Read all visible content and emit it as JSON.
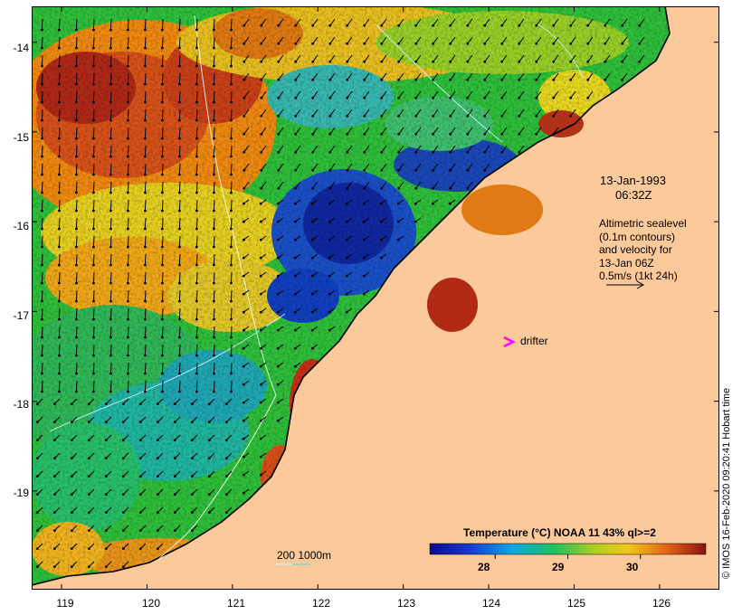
{
  "map": {
    "date_line": "13-Jan-1993",
    "time_line": "06:32Z",
    "legend_lines": [
      "Altimetric sealevel",
      "(0.1m contours)",
      "and velocity for",
      "13-Jan 06Z",
      "0.5m/s (1kt 24h)"
    ],
    "drifter_label": "drifter",
    "depth_label": "200  1000m",
    "colorbar_title": "Temperature (°C) NOAA 11 43% ql>=2",
    "colorbar_ticks": [
      "28",
      "29",
      "30"
    ],
    "colorbar_tick_values": [
      28,
      29,
      30
    ],
    "colorbar_range": [
      27.1,
      30.9
    ],
    "credit": "© IMOS 16-Feb-2020 09:20:41 Hobart time",
    "lon_ticks": [
      "119",
      "120",
      "121",
      "122",
      "123",
      "124",
      "125",
      "126"
    ],
    "lat_ticks": [
      "-14",
      "-15",
      "-16",
      "-17",
      "-18",
      "-19"
    ],
    "lon_values": [
      119,
      120,
      121,
      122,
      123,
      124,
      125,
      126
    ],
    "lat_values": [
      -14,
      -15,
      -16,
      -17,
      -18,
      -19
    ],
    "lon_range": [
      118.65,
      126.7
    ],
    "lat_range": [
      -13.6,
      -20.1
    ],
    "colors": {
      "land": "#fcc99a",
      "drifter_marker": "#ff00ff",
      "contour_lines": "#c8f0ff"
    }
  }
}
